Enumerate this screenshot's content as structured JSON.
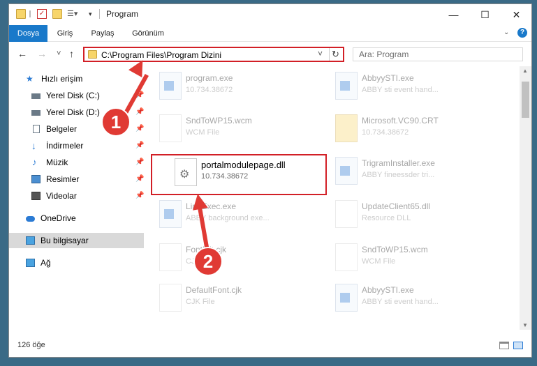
{
  "window": {
    "title": "Program"
  },
  "window_buttons": {
    "minimize": "—",
    "maximize": "☐",
    "close": "✕"
  },
  "ribbon": {
    "tabs": [
      "Dosya",
      "Giriş",
      "Paylaş",
      "Görünüm"
    ],
    "help": "?"
  },
  "nav": {
    "back": "←",
    "forward": "→",
    "recent": "˅",
    "up": "↑"
  },
  "address": {
    "path": "C:\\Program Files\\Program Dizini",
    "dropdown": "˅",
    "refresh": "↻"
  },
  "search": {
    "placeholder": "Ara: Program"
  },
  "sidebar": {
    "quick_access": "Hızlı erişim",
    "items": [
      "Yerel Disk (C:)",
      "Yerel Disk (D:)",
      "Belgeler",
      "İndirmeler",
      "Müzik",
      "Resimler",
      "Videolar"
    ],
    "onedrive": "OneDrive",
    "this_pc": "Bu bilgisayar",
    "network": "Ağ"
  },
  "files": [
    {
      "name": "program.exe",
      "sub": "10.734.38672"
    },
    {
      "name": "AbbyySTI.exe",
      "sub": "ABBY sti event hand..."
    },
    {
      "name": "SndToWP15.wcm",
      "sub": "WCM File"
    },
    {
      "name": "Microsoft.VC90.CRT",
      "sub": "10.734.38672"
    },
    {
      "name": "portalmodulepage.dll",
      "sub": "10.734.38672"
    },
    {
      "name": "TrigramInstaller.exe",
      "sub": "ABBY fineessder tri..."
    },
    {
      "name": "LineExec.exe",
      "sub": "ABBY background exe..."
    },
    {
      "name": "UpdateClient65.dll",
      "sub": "Resource DLL"
    },
    {
      "name": "FontInit.cjk",
      "sub": "CJK File"
    },
    {
      "name": "SndToWP15.wcm",
      "sub": "WCM File"
    },
    {
      "name": "DefaultFont.cjk",
      "sub": "CJK File"
    },
    {
      "name": "AbbyySTI.exe",
      "sub": "ABBY sti event hand..."
    }
  ],
  "status": {
    "count": "126 öğe"
  },
  "annotations": {
    "badge1": "1",
    "badge2": "2"
  },
  "colors": {
    "accent": "#1979ca",
    "highlight": "#d21f26",
    "badge": "#e03a34"
  }
}
